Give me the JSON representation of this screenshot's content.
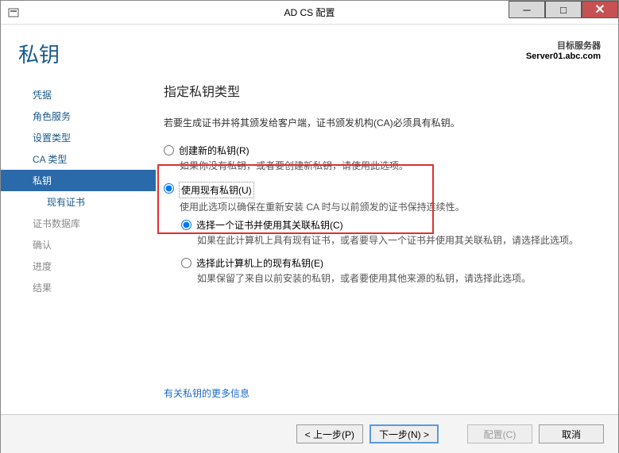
{
  "window": {
    "title": "AD CS 配置"
  },
  "header": {
    "page_title": "私钥",
    "target_label": "目标服务器",
    "target_server": "Server01.abc.com"
  },
  "sidebar": {
    "items": [
      {
        "label": "凭据",
        "state": "enabled"
      },
      {
        "label": "角色服务",
        "state": "enabled"
      },
      {
        "label": "设置类型",
        "state": "enabled"
      },
      {
        "label": "CA 类型",
        "state": "enabled"
      },
      {
        "label": "私钥",
        "state": "selected"
      },
      {
        "label": "现有证书",
        "state": "enabled",
        "sub": true
      },
      {
        "label": "证书数据库",
        "state": "disabled"
      },
      {
        "label": "确认",
        "state": "disabled"
      },
      {
        "label": "进度",
        "state": "disabled"
      },
      {
        "label": "结果",
        "state": "disabled"
      }
    ]
  },
  "panel": {
    "heading": "指定私钥类型",
    "intro": "若要生成证书并将其颁发给客户端，证书颁发机构(CA)必须具有私钥。",
    "opt_create": {
      "label": "创建新的私钥(R)",
      "desc": "如果你没有私钥，或者要创建新私钥，请使用此选项。"
    },
    "opt_existing": {
      "label": "使用现有私钥(U)",
      "desc": "使用此选项以确保在重新安装 CA 时与以前颁发的证书保持连续性。",
      "sub_cert": {
        "label": "选择一个证书并使用其关联私钥(C)",
        "desc": "如果在此计算机上具有现有证书，或者要导入一个证书并使用其关联私钥，请选择此选项。"
      },
      "sub_machine": {
        "label": "选择此计算机上的现有私钥(E)",
        "desc": "如果保留了来自以前安装的私钥，或者要使用其他来源的私钥，请选择此选项。"
      }
    },
    "more_link": "有关私钥的更多信息"
  },
  "footer": {
    "prev": "< 上一步(P)",
    "next": "下一步(N) >",
    "configure": "配置(C)",
    "cancel": "取消"
  }
}
